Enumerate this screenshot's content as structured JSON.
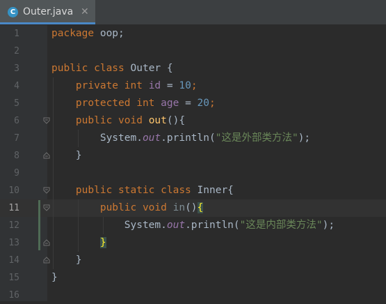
{
  "tab": {
    "icon_letter": "C",
    "title": "Outer.java",
    "close": "✕"
  },
  "lines": [
    {
      "n": "1",
      "parts": [
        {
          "t": "package ",
          "c": "kw"
        },
        {
          "t": "oop;",
          "c": ""
        }
      ]
    },
    {
      "n": "2",
      "parts": []
    },
    {
      "n": "3",
      "parts": [
        {
          "t": "public class ",
          "c": "kw"
        },
        {
          "t": "Outer {",
          "c": ""
        }
      ]
    },
    {
      "n": "4",
      "parts": [
        {
          "t": "    ",
          "c": ""
        },
        {
          "t": "private int ",
          "c": "kw"
        },
        {
          "t": "id",
          "c": "field"
        },
        {
          "t": " = ",
          "c": ""
        },
        {
          "t": "10",
          "c": "num-lit"
        },
        {
          "t": ";",
          "c": "kw"
        }
      ]
    },
    {
      "n": "5",
      "parts": [
        {
          "t": "    ",
          "c": ""
        },
        {
          "t": "protected int ",
          "c": "kw"
        },
        {
          "t": "age",
          "c": "field"
        },
        {
          "t": " = ",
          "c": ""
        },
        {
          "t": "20",
          "c": "num-lit"
        },
        {
          "t": ";",
          "c": "kw"
        }
      ]
    },
    {
      "n": "6",
      "parts": [
        {
          "t": "    ",
          "c": ""
        },
        {
          "t": "public void ",
          "c": "kw"
        },
        {
          "t": "out",
          "c": "method"
        },
        {
          "t": "(){",
          "c": ""
        }
      ]
    },
    {
      "n": "7",
      "parts": [
        {
          "t": "        System.",
          "c": ""
        },
        {
          "t": "out",
          "c": "static"
        },
        {
          "t": ".println(",
          "c": ""
        },
        {
          "t": "\"这是外部类方法\"",
          "c": "str"
        },
        {
          "t": ");",
          "c": ""
        }
      ]
    },
    {
      "n": "8",
      "parts": [
        {
          "t": "    }",
          "c": ""
        }
      ]
    },
    {
      "n": "9",
      "parts": []
    },
    {
      "n": "10",
      "parts": [
        {
          "t": "    ",
          "c": ""
        },
        {
          "t": "public static class ",
          "c": "kw"
        },
        {
          "t": "Inner{",
          "c": ""
        }
      ]
    },
    {
      "n": "11",
      "current": true,
      "parts": [
        {
          "t": "        ",
          "c": ""
        },
        {
          "t": "public void ",
          "c": "kw"
        },
        {
          "t": "in",
          "c": "unused"
        },
        {
          "t": "()",
          "c": ""
        },
        {
          "t": "{",
          "c": "brace-hl"
        }
      ]
    },
    {
      "n": "12",
      "parts": [
        {
          "t": "            System.",
          "c": ""
        },
        {
          "t": "out",
          "c": "static"
        },
        {
          "t": ".println(",
          "c": ""
        },
        {
          "t": "\"这是内部类方法\"",
          "c": "str"
        },
        {
          "t": ");",
          "c": ""
        }
      ]
    },
    {
      "n": "13",
      "parts": [
        {
          "t": "        ",
          "c": ""
        },
        {
          "t": "}",
          "c": "brace-hl"
        }
      ]
    },
    {
      "n": "14",
      "parts": [
        {
          "t": "    }",
          "c": ""
        }
      ]
    },
    {
      "n": "15",
      "parts": [
        {
          "t": "}",
          "c": ""
        }
      ]
    },
    {
      "n": "16",
      "parts": []
    }
  ],
  "colors": {
    "background": "#2B2B2B",
    "keyword": "#CC7832",
    "number": "#6897BB",
    "field": "#9876AA",
    "method": "#FFC66D",
    "string": "#6A8759",
    "text": "#A9B7C6"
  }
}
